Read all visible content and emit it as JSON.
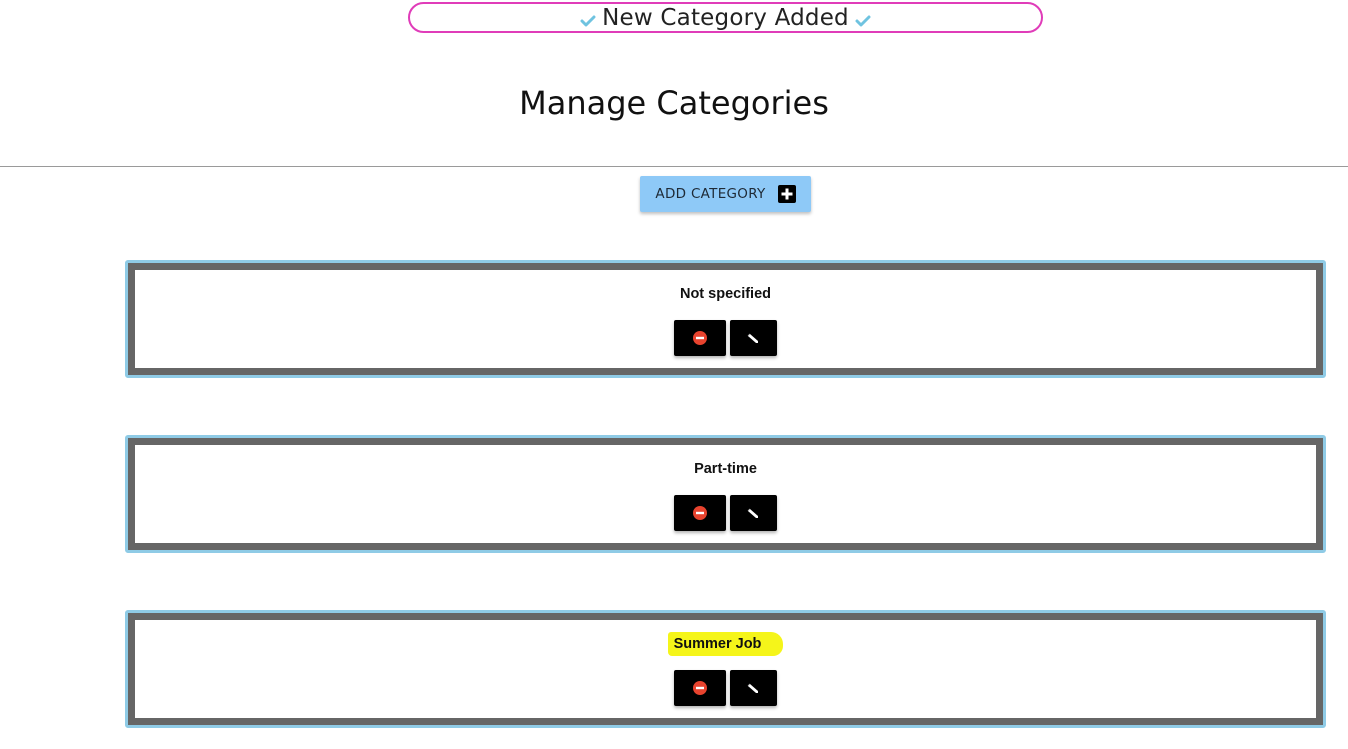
{
  "toast": {
    "message": "New Category Added",
    "icon": "check-icon",
    "border_color": "#e03cb9",
    "icon_color": "#6fc3e0"
  },
  "header": {
    "title": "Manage Categories"
  },
  "toolbar": {
    "add_label": "ADD CATEGORY",
    "add_icon": "plus-box-icon",
    "add_button_color": "#8ec9f7"
  },
  "categories": [
    {
      "name": "Not specified",
      "highlighted": false,
      "delete_icon": "minus-circle-icon",
      "edit_icon": "pencil-icon"
    },
    {
      "name": "Part-time",
      "highlighted": false,
      "delete_icon": "minus-circle-icon",
      "edit_icon": "pencil-icon"
    },
    {
      "name": "Summer Job",
      "highlighted": true,
      "delete_icon": "minus-circle-icon",
      "edit_icon": "pencil-icon"
    }
  ],
  "colors": {
    "card_outer_border": "#8fcbe6",
    "card_inner_border": "#666666",
    "delete_icon": "#e8432e",
    "highlight": "#f5f51a"
  }
}
